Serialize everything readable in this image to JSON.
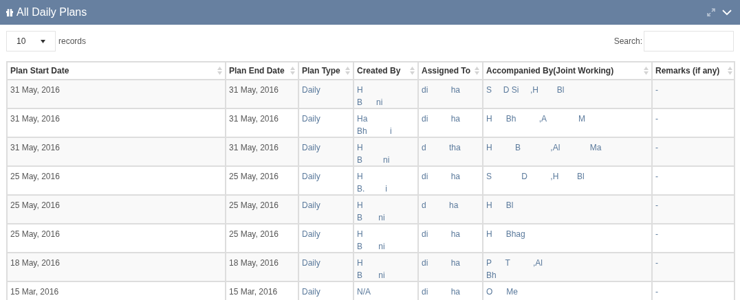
{
  "panel": {
    "title": "All Daily Plans"
  },
  "length_select": {
    "value": "10",
    "label": "records"
  },
  "search": {
    "label": "Search:"
  },
  "table": {
    "columns": [
      "Plan Start Date",
      "Plan End Date",
      "Plan Type",
      "Created By",
      "Assigned To",
      "Accompanied By(Joint Working)",
      "Remarks (if any)"
    ],
    "rows": [
      [
        "31 May, 2016",
        "31 May, 2016",
        "Daily",
        "H\nB      ni",
        "di          ha",
        "S     D Si     ,H        Bl",
        "-"
      ],
      [
        "31 May, 2016",
        "31 May, 2016",
        "Daily",
        "Ha\nBh          i",
        "di          ha",
        "H      Bh          ,A              M",
        "-"
      ],
      [
        "31 May, 2016",
        "31 May, 2016",
        "Daily",
        "H\nB         ni",
        "d          tha",
        "H          B             ,Al             Ma",
        "-"
      ],
      [
        "25 May, 2016",
        "25 May, 2016",
        "Daily",
        "H\nB.         i",
        "di          ha",
        "S             D          ,H        Bl",
        "-"
      ],
      [
        "25 May, 2016",
        "25 May, 2016",
        "Daily",
        "H\nB       ni",
        "d          ha",
        "H      Bl",
        "-"
      ],
      [
        "25 May, 2016",
        "25 May, 2016",
        "Daily",
        "H\nB       ni",
        "di          ha",
        "H      Bhag",
        "-"
      ],
      [
        "18 May, 2016",
        "18 May, 2016",
        "Daily",
        "H\nB       ni",
        "di          ha",
        "P      T          ,Al\nBh",
        "-"
      ],
      [
        "15 Mar, 2016",
        "15 Mar, 2016",
        "Daily",
        "N/A",
        "di          ha",
        "O      Me",
        "-"
      ]
    ]
  }
}
